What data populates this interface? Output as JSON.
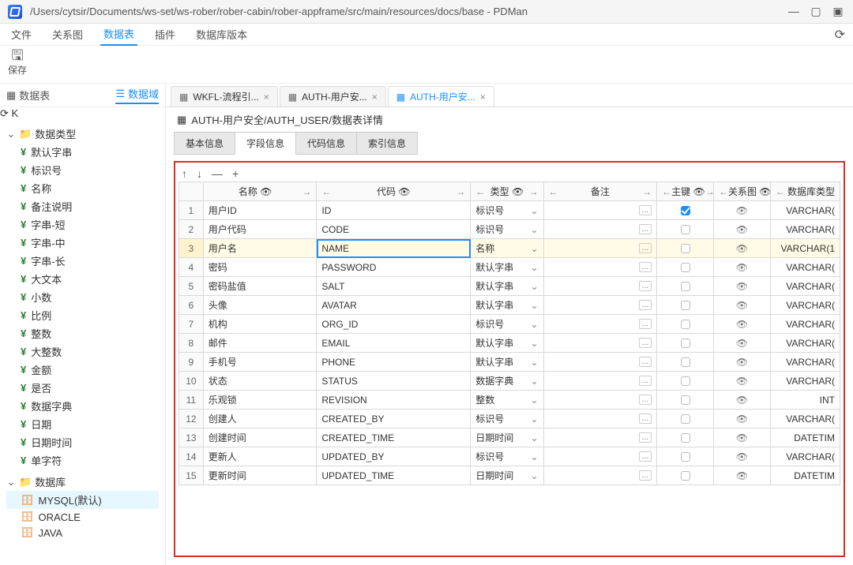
{
  "window": {
    "title": "/Users/cytsir/Documents/ws-set/ws-rober/rober-cabin/rober-appframe/src/main/resources/docs/base - PDMan"
  },
  "menu": {
    "file": "文件",
    "relation": "关系图",
    "datatable": "数据表",
    "plugin": "插件",
    "dbversion": "数据库版本"
  },
  "toolbar": {
    "save": "保存"
  },
  "sidebar": {
    "tabs": {
      "left": "数据表",
      "right": "数据域"
    },
    "groups": [
      {
        "label": "数据类型",
        "items": [
          "默认字串",
          "标识号",
          "名称",
          "备注说明",
          "字串-短",
          "字串-中",
          "字串-长",
          "大文本",
          "小数",
          "比例",
          "整数",
          "大整数",
          "金额",
          "是否",
          "数据字典",
          "日期",
          "日期时间",
          "单字符"
        ]
      },
      {
        "label": "数据库",
        "dbitems": [
          {
            "label": "MYSQL(默认)",
            "selected": true
          },
          {
            "label": "ORACLE",
            "selected": false
          },
          {
            "label": "JAVA",
            "selected": false
          }
        ]
      }
    ]
  },
  "tabs": [
    {
      "label": "WKFL-流程引...",
      "active": false
    },
    {
      "label": "AUTH-用户安...",
      "active": false
    },
    {
      "label": "AUTH-用户安...",
      "active": true
    }
  ],
  "breadcrumb": "AUTH-用户安全/AUTH_USER/数据表详情",
  "subtabs": [
    "基本信息",
    "字段信息",
    "代码信息",
    "索引信息"
  ],
  "subtabs_active": 1,
  "columns": {
    "name": "名称",
    "code": "代码",
    "type": "类型",
    "remark": "备注",
    "pk": "主键",
    "rel": "关系图",
    "dbtype": "数据库类型"
  },
  "rows": [
    {
      "name": "用户ID",
      "code": "ID",
      "type": "标识号",
      "pk": true,
      "dbtype": "VARCHAR("
    },
    {
      "name": "用户代码",
      "code": "CODE",
      "type": "标识号",
      "pk": false,
      "dbtype": "VARCHAR("
    },
    {
      "name": "用户名",
      "code": "NAME",
      "type": "名称",
      "pk": false,
      "dbtype": "VARCHAR(1",
      "selected": true
    },
    {
      "name": "密码",
      "code": "PASSWORD",
      "type": "默认字串",
      "pk": false,
      "dbtype": "VARCHAR("
    },
    {
      "name": "密码盐值",
      "code": "SALT",
      "type": "默认字串",
      "pk": false,
      "dbtype": "VARCHAR("
    },
    {
      "name": "头像",
      "code": "AVATAR",
      "type": "默认字串",
      "pk": false,
      "dbtype": "VARCHAR("
    },
    {
      "name": "机构",
      "code": "ORG_ID",
      "type": "标识号",
      "pk": false,
      "dbtype": "VARCHAR("
    },
    {
      "name": "邮件",
      "code": "EMAIL",
      "type": "默认字串",
      "pk": false,
      "dbtype": "VARCHAR("
    },
    {
      "name": "手机号",
      "code": "PHONE",
      "type": "默认字串",
      "pk": false,
      "dbtype": "VARCHAR("
    },
    {
      "name": "状态",
      "code": "STATUS",
      "type": "数据字典",
      "pk": false,
      "dbtype": "VARCHAR("
    },
    {
      "name": "乐观锁",
      "code": "REVISION",
      "type": "整数",
      "pk": false,
      "dbtype": "INT"
    },
    {
      "name": "创建人",
      "code": "CREATED_BY",
      "type": "标识号",
      "pk": false,
      "dbtype": "VARCHAR("
    },
    {
      "name": "创建时间",
      "code": "CREATED_TIME",
      "type": "日期时间",
      "pk": false,
      "dbtype": "DATETIM"
    },
    {
      "name": "更新人",
      "code": "UPDATED_BY",
      "type": "标识号",
      "pk": false,
      "dbtype": "VARCHAR("
    },
    {
      "name": "更新时间",
      "code": "UPDATED_TIME",
      "type": "日期时间",
      "pk": false,
      "dbtype": "DATETIM"
    }
  ]
}
